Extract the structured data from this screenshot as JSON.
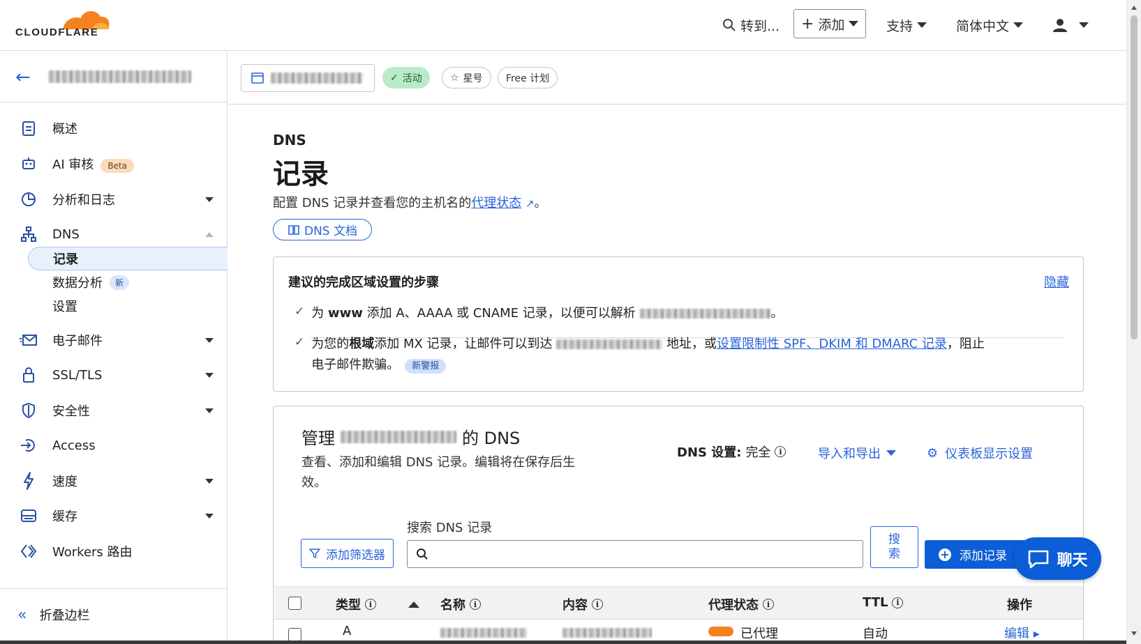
{
  "header": {
    "logo_text": "CLOUDFLARE",
    "goto_label": "转到...",
    "add_label": "添加",
    "support_label": "支持",
    "language_label": "简体中文",
    "brand_color": "#f6821f"
  },
  "sidebar": {
    "items": [
      {
        "label": "概述",
        "icon": "clipboard-icon"
      },
      {
        "label": "AI 审核",
        "badge": "Beta",
        "icon": "robot-icon"
      },
      {
        "label": "分析和日志",
        "icon": "chart-pie-icon"
      },
      {
        "label": "DNS",
        "icon": "network-icon"
      },
      {
        "label": "电子邮件",
        "icon": "mail-icon"
      },
      {
        "label": "SSL/TLS",
        "icon": "lock-icon"
      },
      {
        "label": "安全性",
        "icon": "shield-icon"
      },
      {
        "label": "Access",
        "icon": "sign-in-icon"
      },
      {
        "label": "速度",
        "icon": "lightning-icon"
      },
      {
        "label": "缓存",
        "icon": "storage-icon"
      },
      {
        "label": "Workers 路由",
        "icon": "workers-icon"
      }
    ],
    "dns_sub": [
      {
        "label": "记录"
      },
      {
        "label": "数据分析",
        "badge": "新"
      },
      {
        "label": "设置"
      }
    ],
    "collapse_label": "折叠边栏"
  },
  "zonebar": {
    "status_label": "活动",
    "star_label": "星号",
    "plan_label": "Free 计划"
  },
  "page": {
    "section": "DNS",
    "title": "记录",
    "desc_prefix": "配置 DNS 记录并查看您的主机名的",
    "desc_link": "代理状态",
    "desc_suffix": "。",
    "doc_button": "DNS 文档"
  },
  "steps": {
    "title": "建议的完成区域设置的步骤",
    "hide": "隐藏",
    "step1_a": "为 ",
    "step1_bold": "www",
    "step1_b": " 添加 A、AAAA 或 CNAME 记录，以便可以解析 ",
    "step1_c": "。",
    "step2_a": "为您的",
    "step2_bold": "根域",
    "step2_b": "添加 MX 记录，让邮件可以到达 ",
    "step2_c": " 地址，或",
    "step2_link": "设置限制性 SPF、DKIM 和 DMARC 记录",
    "step2_d": "，阻止",
    "step2_e": "电子邮件欺骗。",
    "step2_badge": "新警报"
  },
  "manage": {
    "title_prefix": "管理",
    "title_suffix": "的 DNS",
    "desc": "查看、添加和编辑 DNS 记录。编辑将在保存后生效。",
    "settings_label": "DNS 设置:",
    "settings_value": "完全",
    "import_export": "导入和导出",
    "dashboard_settings": "仪表板显示设置",
    "filter_button": "添加筛选器",
    "search_label": "搜索 DNS 记录",
    "search_placeholder": "",
    "search_button": "搜索",
    "add_record_button": "添加记录",
    "columns": [
      "类型",
      "名称",
      "内容",
      "代理状态",
      "TTL",
      "操作"
    ],
    "row1": {
      "type": "A",
      "proxy": "已代理",
      "ttl": "自动",
      "action": "编辑"
    }
  },
  "chat": {
    "label": "聊天"
  }
}
